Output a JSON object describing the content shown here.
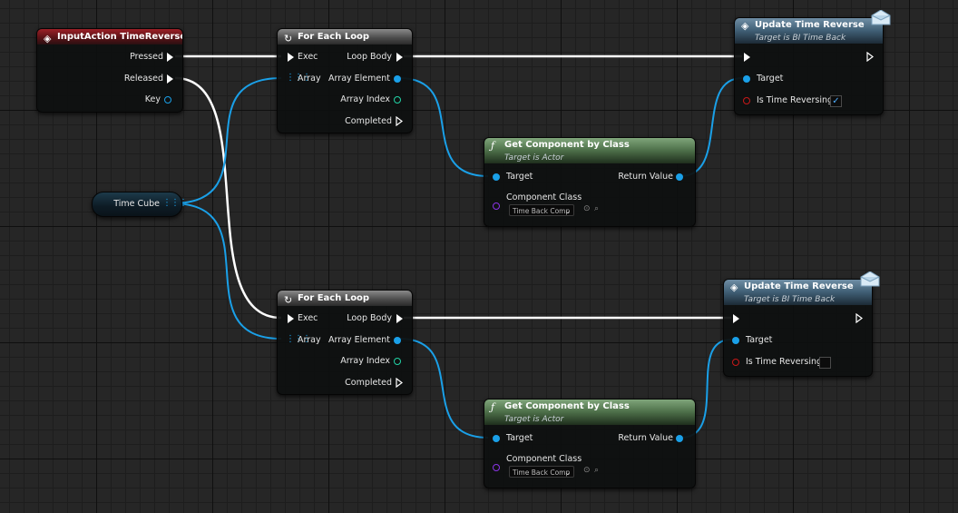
{
  "input_action": {
    "title": "InputAction TimeReverse",
    "pins": {
      "pressed": "Pressed",
      "released": "Released",
      "key": "Key"
    }
  },
  "loop_1": {
    "title": "For Each Loop",
    "pins": {
      "exec": "Exec",
      "array": "Array",
      "loop_body": "Loop Body",
      "array_element": "Array Element",
      "array_index": "Array Index",
      "completed": "Completed"
    }
  },
  "loop_2": {
    "title": "For Each Loop",
    "pins": {
      "exec": "Exec",
      "array": "Array",
      "loop_body": "Loop Body",
      "array_element": "Array Element",
      "array_index": "Array Index",
      "completed": "Completed"
    }
  },
  "time_cube": {
    "label": "Time Cube"
  },
  "get_comp_1": {
    "title": "Get Component by Class",
    "subtitle": "Target is Actor",
    "pins": {
      "target": "Target",
      "return_value": "Return Value",
      "component_class": "Component Class"
    },
    "class_value": "Time Back Comp"
  },
  "get_comp_2": {
    "title": "Get Component by Class",
    "subtitle": "Target is Actor",
    "pins": {
      "target": "Target",
      "return_value": "Return Value",
      "component_class": "Component Class"
    },
    "class_value": "Time Back Comp"
  },
  "update_1": {
    "title": "Update Time Reverse",
    "subtitle": "Target is BI Time Back",
    "pins": {
      "target": "Target",
      "is_time_reversing": "Is Time Reversing?"
    },
    "is_time_reversing": true,
    "check_glyph": "✓"
  },
  "update_2": {
    "title": "Update Time Reverse",
    "subtitle": "Target is BI Time Back",
    "pins": {
      "target": "Target",
      "is_time_reversing": "Is Time Reversing?"
    },
    "is_time_reversing": false,
    "check_glyph": ""
  },
  "icons": {
    "event": "diamond-icon",
    "loop": "loop-icon",
    "function": "function-icon",
    "message": "envelope-icon",
    "array": "array-grid-icon"
  },
  "colors": {
    "exec_wire": "#ffffff",
    "object_wire": "#1aa0e8",
    "event_header": "#8f1d24",
    "macro_header": "#6e6e6e",
    "message_header": "#5a7b93",
    "pure_function_header": "#6a9266",
    "bool_pin": "#c81818",
    "int_pin": "#22d3a6",
    "class_pin": "#8a34e6",
    "canvas": "#262626"
  }
}
